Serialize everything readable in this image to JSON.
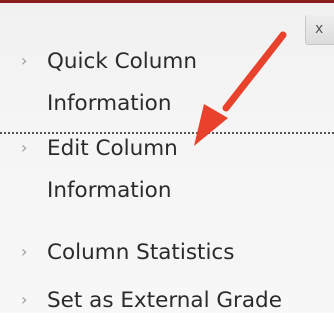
{
  "close_button": {
    "label": "x"
  },
  "menu": {
    "items": [
      {
        "label": "Quick Column Information"
      },
      {
        "label": "Edit Column Information"
      },
      {
        "label": "Column Statistics"
      },
      {
        "label": "Set as External Grade"
      }
    ]
  },
  "annotation": {
    "arrow_color": "#e8412c"
  },
  "colors": {
    "top_border": "#8c1d1d",
    "chevron": "#9a9a9a",
    "text": "#2b2b2b"
  }
}
